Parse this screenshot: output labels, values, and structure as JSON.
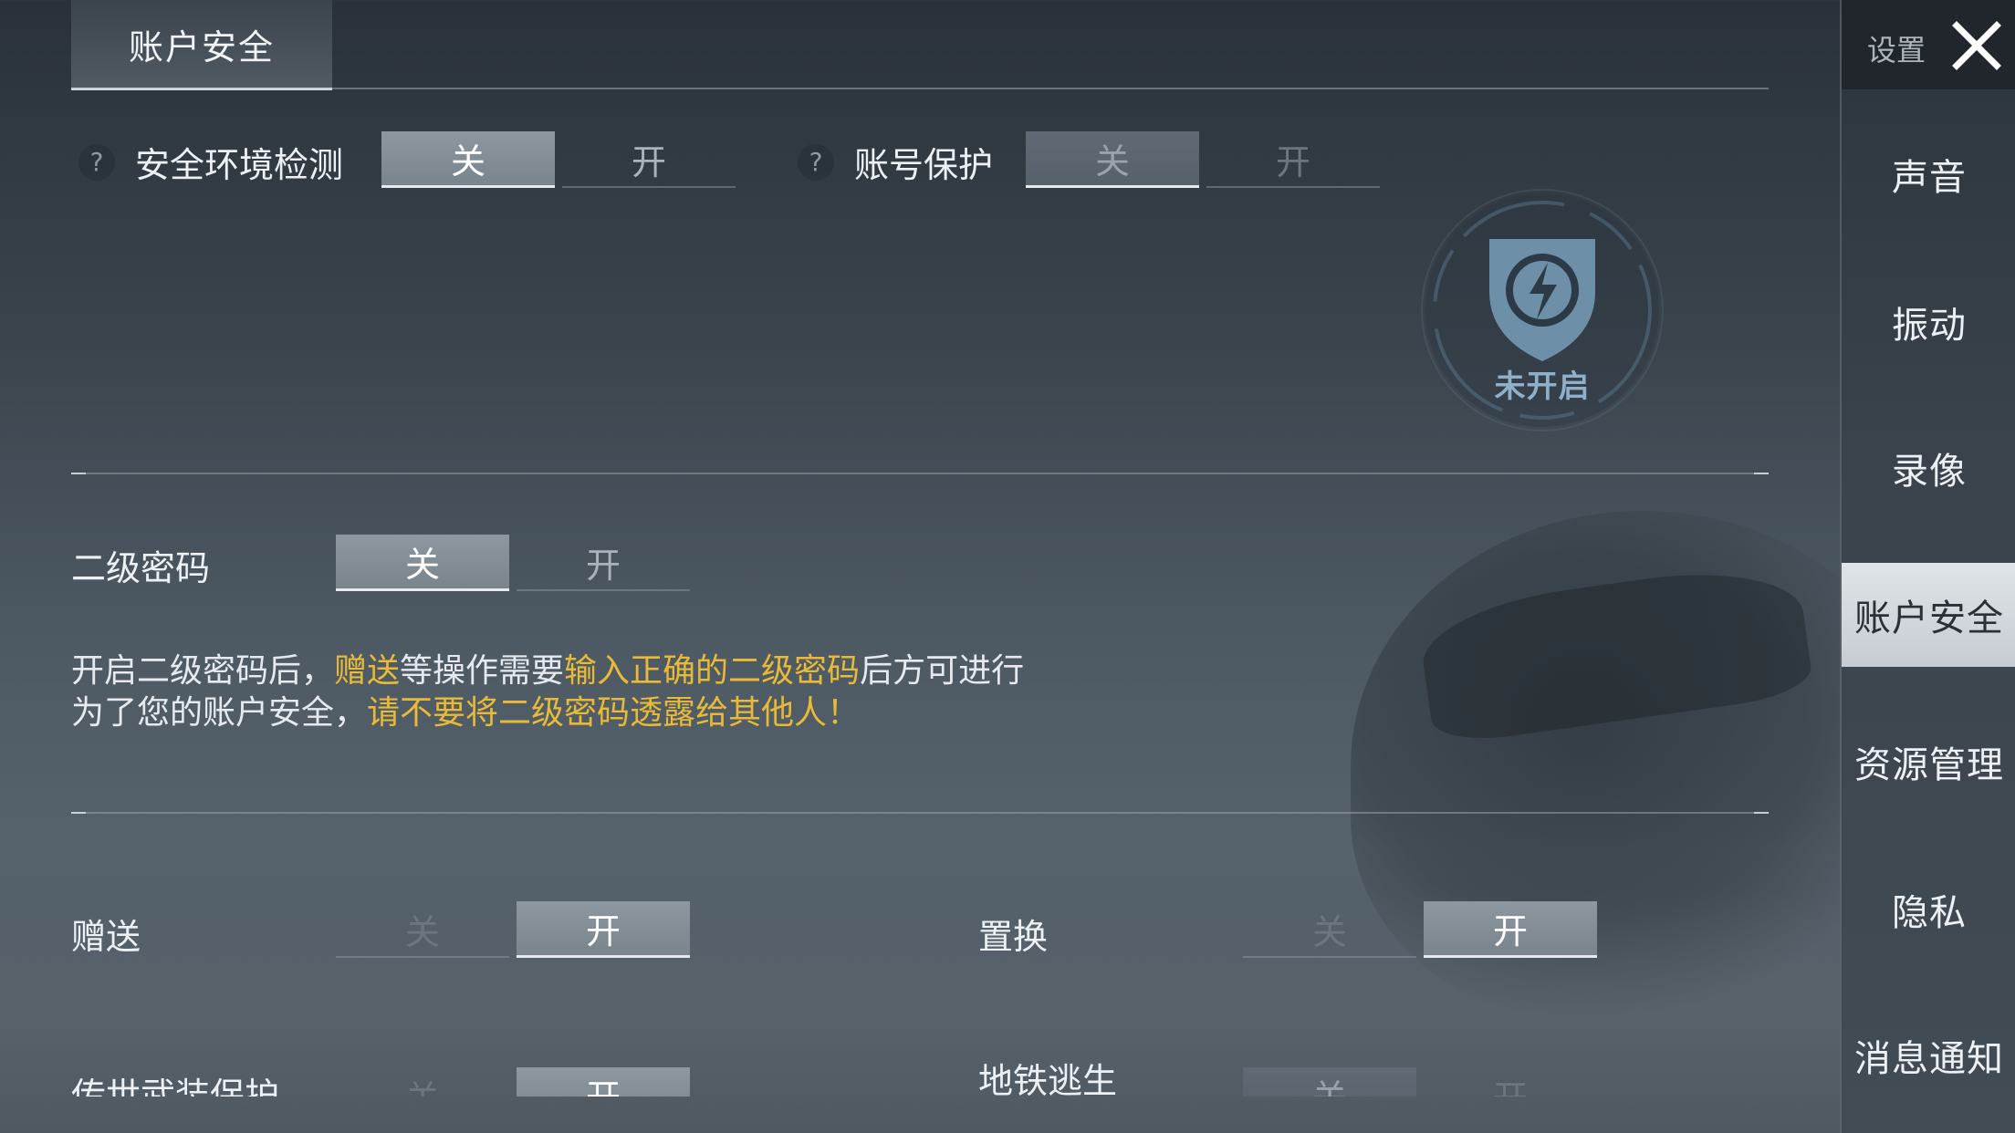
{
  "top_tab": {
    "label": "账户安全"
  },
  "security_env": {
    "label": "安全环境检测",
    "help": "?",
    "off": "关",
    "on": "开",
    "state": "off"
  },
  "account_protect": {
    "label": "账号保护",
    "help": "?",
    "off": "关",
    "on": "开",
    "state": "off"
  },
  "emblem": {
    "status": "未开启"
  },
  "second_password": {
    "label": "二级密码",
    "off": "关",
    "on": "开",
    "state": "off",
    "info_line1": {
      "a": "开启二级密码后，",
      "b": "赠送",
      "c": "等操作需要",
      "d": "输入正确的二级密码",
      "e": "后方可进行"
    },
    "info_line2": {
      "a": "为了您的账户安全，",
      "b": "请不要将二级密码透露给其他人！"
    }
  },
  "gift": {
    "label": "赠送",
    "off": "关",
    "on": "开",
    "state": "on"
  },
  "swap": {
    "label": "置换",
    "off": "关",
    "on": "开",
    "state": "on"
  },
  "legend_gear": {
    "label": "传世武装保护",
    "off": "关",
    "on": "开",
    "state": "on"
  },
  "metro": {
    "label": "地铁逃生",
    "off": "关",
    "on": "开",
    "state": "off"
  },
  "sidebar": {
    "title": "设置",
    "items": [
      {
        "label": "声音"
      },
      {
        "label": "振动"
      },
      {
        "label": "录像"
      },
      {
        "label": "账户安全",
        "active": true
      },
      {
        "label": "资源管理"
      },
      {
        "label": "隐私"
      },
      {
        "label": "消息通知"
      }
    ]
  },
  "colors": {
    "highlight": "#e9b938",
    "emblem": "#6e8fa8",
    "emblem_text": "#8fb0c8"
  }
}
